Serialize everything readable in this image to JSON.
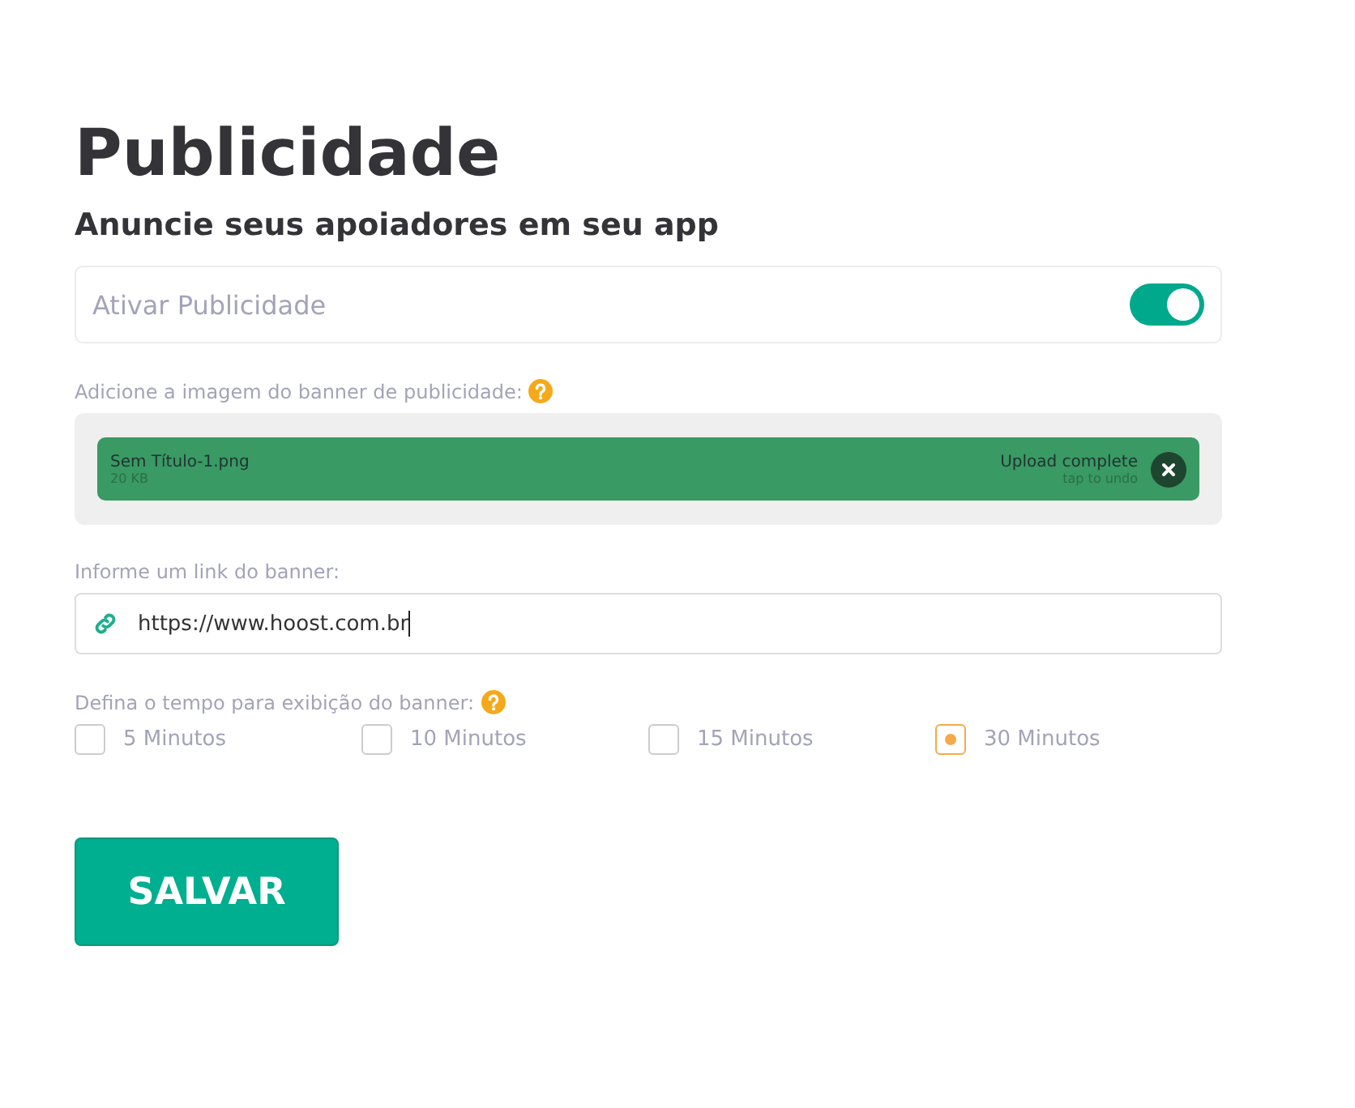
{
  "title": "Publicidade",
  "subtitle": "Anuncie seus apoiadores em seu app",
  "toggle": {
    "label": "Ativar Publicidade",
    "on": true
  },
  "banner_upload": {
    "label": "Adicione a imagem do banner de publicidade:",
    "file": {
      "name": "Sem Título-1.png",
      "size": "20 KB",
      "status": "Upload complete",
      "hint": "tap to undo"
    }
  },
  "link": {
    "label": "Informe um link do banner:",
    "value": "https://www.hoost.com.br"
  },
  "duration": {
    "label": "Defina o tempo para exibição do banner:",
    "options": [
      {
        "label": "5 Minutos",
        "selected": false
      },
      {
        "label": "10 Minutos",
        "selected": false
      },
      {
        "label": "15 Minutos",
        "selected": false
      },
      {
        "label": "30 Minutos",
        "selected": true
      }
    ]
  },
  "save_button": "SALVAR"
}
